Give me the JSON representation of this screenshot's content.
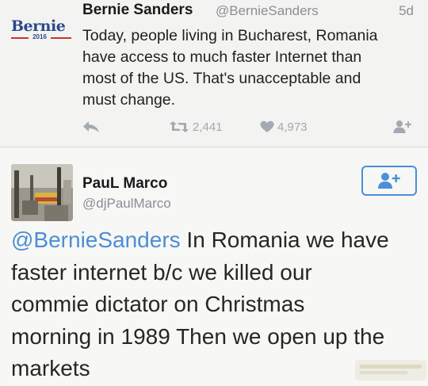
{
  "tweet1": {
    "logo_text": "Bernie",
    "logo_year": "2016",
    "author_name": "Bernie Sanders",
    "author_handle": "@BernieSanders",
    "time": "5d",
    "text_lines": [
      "Today, people living in Bucharest, Romania",
      "have access to much faster Internet than",
      "most of the US. That's unacceptable and",
      "must change."
    ],
    "actions": {
      "reply_icon": "reply-icon",
      "retweet_icon": "retweet-icon",
      "retweet_count": "2,441",
      "like_icon": "heart-icon",
      "like_count": "4,973",
      "follow_icon": "follow-user-icon"
    }
  },
  "tweet2": {
    "author_name": "PauL Marco",
    "author_handle": "@djPaulMarco",
    "follow_icon": "follow-user-icon",
    "mention": "@BernieSanders",
    "text_after_mention": " In Romania we have",
    "text_lines": [
      "faster internet b/c we killed our",
      "commie dictator on Christmas",
      "morning in 1989  Then we open up the",
      "markets"
    ]
  },
  "colors": {
    "link_blue": "#4b8ed6",
    "muted_gray": "#8a8f96",
    "icon_gray": "#a3a9b0",
    "logo_blue": "#2b4a8b",
    "logo_red": "#c8352f"
  }
}
